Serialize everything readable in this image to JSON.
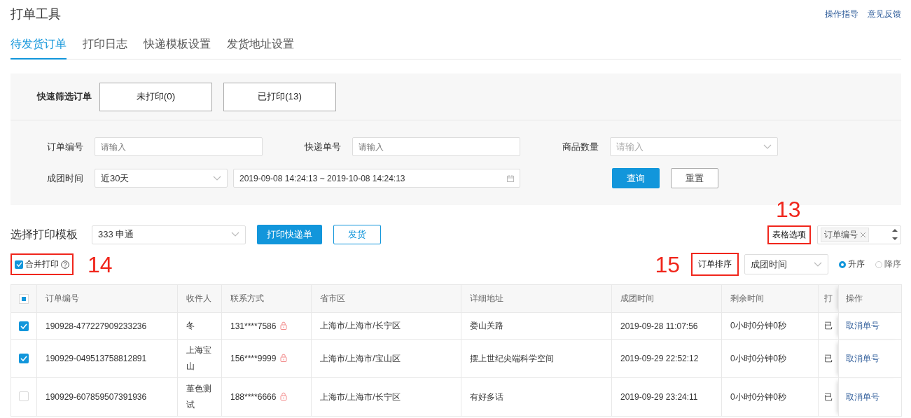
{
  "header": {
    "title": "打单工具",
    "links": [
      "操作指导",
      "意见反馈"
    ]
  },
  "tabs": [
    {
      "label": "待发货订单",
      "selected": true
    },
    {
      "label": "打印日志",
      "selected": false
    },
    {
      "label": "快递模板设置",
      "selected": false
    },
    {
      "label": "发货地址设置",
      "selected": false
    }
  ],
  "quick_filter": {
    "label": "快速筛选订单",
    "buttons": [
      "未打印(0)",
      "已打印(13)"
    ]
  },
  "filters": {
    "order_no": {
      "label": "订单编号",
      "placeholder": "请输入"
    },
    "tracking_no": {
      "label": "快递单号",
      "placeholder": "请输入"
    },
    "quantity": {
      "label": "商品数量",
      "placeholder": "请输入"
    },
    "group_time": {
      "label": "成团时间",
      "value": "近30天",
      "range": "2019-09-08 14:24:13 ~ 2019-10-08 14:24:13"
    },
    "buttons": [
      "查询",
      "重置"
    ]
  },
  "template": {
    "label": "选择打印模板",
    "value": "333 申通",
    "print_button": "打印快递单",
    "ship_button": "发货"
  },
  "table_options": {
    "label": "表格选项",
    "highlighted": true,
    "marker": "13",
    "tags": [
      "订单编号"
    ]
  },
  "merge_print": {
    "label": "合并打印",
    "checked": true,
    "highlighted": true,
    "marker": "14"
  },
  "sort": {
    "label": "订单排序",
    "highlighted": true,
    "marker": "15",
    "value": "成团时间",
    "options": [
      {
        "label": "升序",
        "selected": true
      },
      {
        "label": "降序",
        "selected": false
      }
    ]
  },
  "table": {
    "columns": [
      "订单编号",
      "收件人",
      "联系方式",
      "省市区",
      "详细地址",
      "成团时间",
      "剩余时间",
      "打",
      "操作"
    ],
    "header_indeterminate": true,
    "rows": [
      {
        "checked": true,
        "cells": [
          "190928-477227909233236",
          "冬",
          "131****7586",
          "上海市/上海市/长宁区",
          "娄山关路",
          "2019-09-28 11:07:56",
          "0小时0分钟0秒",
          "已",
          "取消单号"
        ]
      },
      {
        "checked": true,
        "cells": [
          "190929-049513758812891",
          "上海宝山",
          "156****9999",
          "上海市/上海市/宝山区",
          "摆上世纪尖端科学空间",
          "2019-09-29 22:52:12",
          "0小时0分钟0秒",
          "已",
          "取消单号"
        ]
      },
      {
        "checked": false,
        "cells": [
          "190929-607859507391936",
          "堇色测试",
          "188****6666",
          "上海市/上海市/长宁区",
          "有好多话",
          "2019-09-29 23:24:11",
          "0小时0分钟0秒",
          "已",
          "取消单号"
        ]
      }
    ]
  }
}
